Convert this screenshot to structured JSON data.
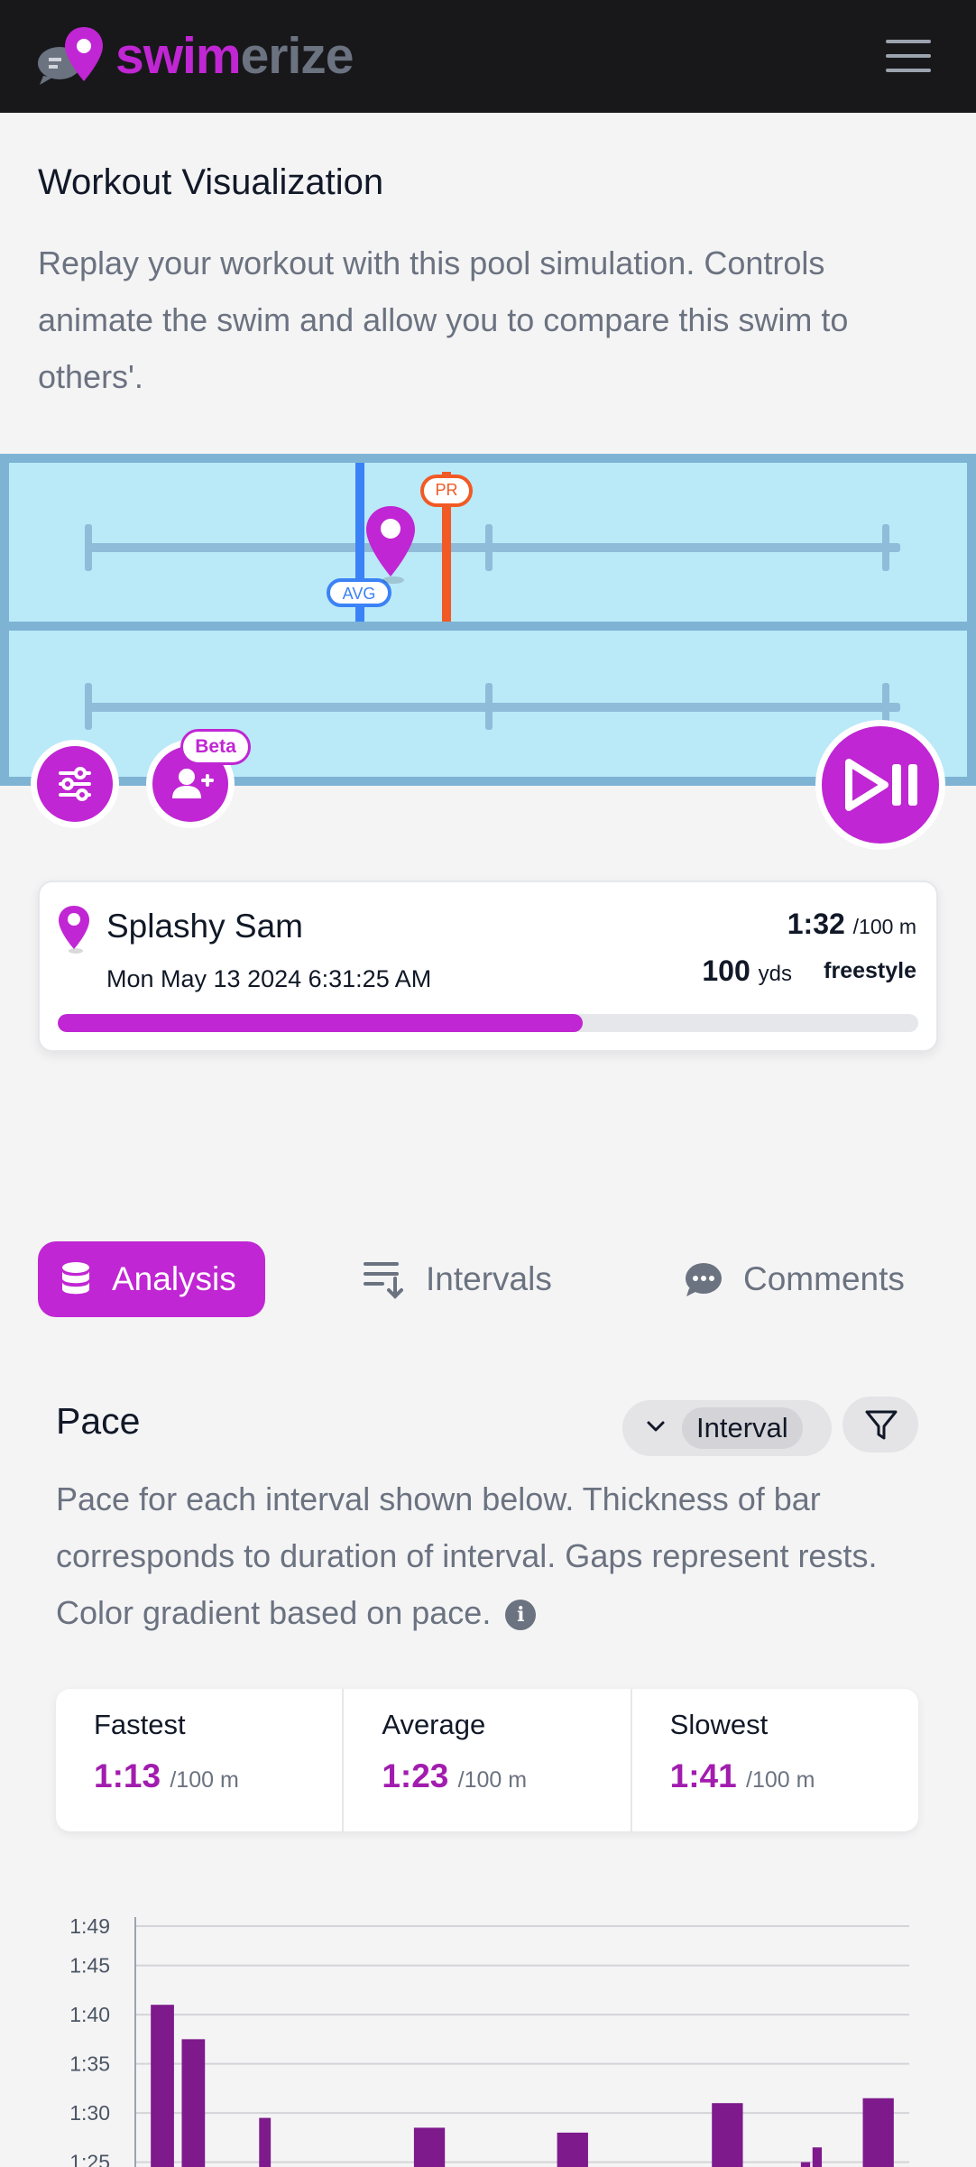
{
  "header": {
    "brand_part1": "swim",
    "brand_part2": "erize",
    "menu_icon": "hamburger-menu-icon",
    "logo_icon": "chat-pin-logo-icon"
  },
  "intro": {
    "title": "Workout Visualization",
    "description": "Replay your workout with this pool simulation. Controls animate the swim and allow you to compare this swim to others'."
  },
  "pool": {
    "avg_label": "AVG",
    "pr_label": "PR",
    "beta_label": "Beta",
    "colors": {
      "water": "#bae9f8",
      "avg": "#3b82f6",
      "pr": "#f15a24",
      "accent": "#c026d3"
    }
  },
  "swimmer": {
    "name": "Splashy Sam",
    "date": "Mon May 13 2024 6:31:25 AM",
    "pace": "1:32",
    "pace_unit": "/100 m",
    "distance": "100",
    "distance_unit": "yds",
    "stroke": "freestyle",
    "progress": 0.61
  },
  "tabs": [
    {
      "label": "Analysis",
      "icon": "database-icon",
      "active": true
    },
    {
      "label": "Intervals",
      "icon": "list-sort-icon",
      "active": false
    },
    {
      "label": "Comments",
      "icon": "chat-bubble-icon",
      "active": false
    }
  ],
  "pace": {
    "title": "Pace",
    "select_value": "Interval",
    "description": "Pace for each interval shown below. Thickness of bar corresponds to duration of interval. Gaps represent rests. Color gradient based on pace.",
    "stats": [
      {
        "label": "Fastest",
        "value": "1:13",
        "unit": "/100 m"
      },
      {
        "label": "Average",
        "value": "1:23",
        "unit": "/100 m"
      },
      {
        "label": "Slowest",
        "value": "1:41",
        "unit": "/100 m"
      }
    ]
  },
  "chart_data": {
    "type": "bar",
    "ytick_labels": [
      "1:49",
      "1:45",
      "1:40",
      "1:35",
      "1:30",
      "1:25"
    ],
    "yticks": [
      109,
      105,
      100,
      95,
      90,
      85
    ],
    "ylim": [
      83,
      109
    ],
    "bars": [
      {
        "start": 0.02,
        "end": 0.05,
        "value": 101
      },
      {
        "start": 0.06,
        "end": 0.09,
        "value": 97.5
      },
      {
        "start": 0.16,
        "end": 0.175,
        "value": 89.5
      },
      {
        "start": 0.36,
        "end": 0.4,
        "value": 88.5
      },
      {
        "start": 0.545,
        "end": 0.585,
        "value": 88
      },
      {
        "start": 0.745,
        "end": 0.785,
        "value": 91
      },
      {
        "start": 0.86,
        "end": 0.872,
        "value": 85
      },
      {
        "start": 0.875,
        "end": 0.887,
        "value": 86.5
      },
      {
        "start": 0.94,
        "end": 0.98,
        "value": 91.5
      }
    ],
    "bar_color": "#7e1a8c"
  }
}
